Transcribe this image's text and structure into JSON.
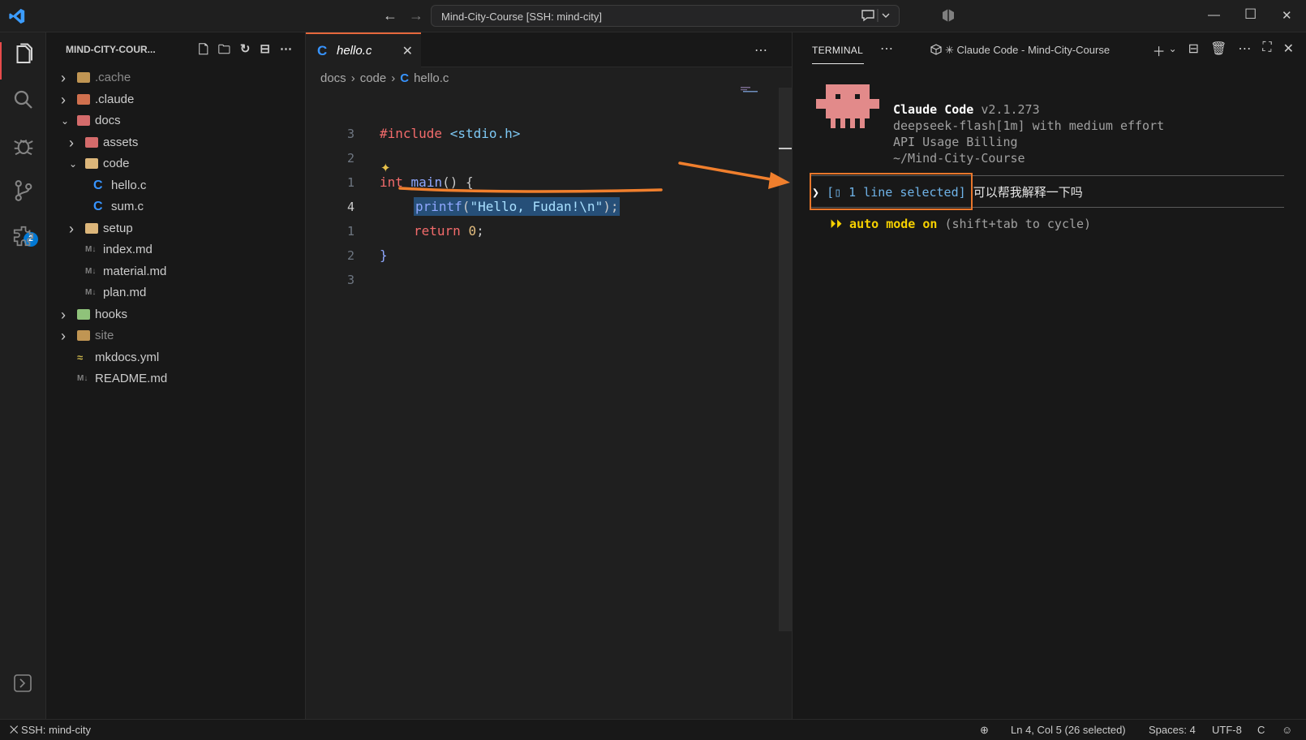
{
  "window": {
    "command_center": "Mind-City-Course [SSH: mind-city]"
  },
  "activity_bar": {
    "scm_badge": "2"
  },
  "explorer": {
    "title": "MIND-CITY-COUR...",
    "items": [
      {
        "label": ".cache",
        "type": "folder",
        "expanded": false,
        "dim": true
      },
      {
        "label": ".claude",
        "type": "folder",
        "expanded": false
      },
      {
        "label": "docs",
        "type": "folder",
        "expanded": true
      },
      {
        "label": "assets",
        "type": "folder",
        "expanded": false
      },
      {
        "label": "code",
        "type": "folder",
        "expanded": true
      },
      {
        "label": "hello.c",
        "type": "c-file"
      },
      {
        "label": "sum.c",
        "type": "c-file"
      },
      {
        "label": "setup",
        "type": "folder",
        "expanded": false
      },
      {
        "label": "index.md",
        "type": "md-file"
      },
      {
        "label": "material.md",
        "type": "md-file"
      },
      {
        "label": "plan.md",
        "type": "md-file"
      },
      {
        "label": "hooks",
        "type": "folder",
        "expanded": false
      },
      {
        "label": "site",
        "type": "folder",
        "expanded": false,
        "dim": true
      },
      {
        "label": "mkdocs.yml",
        "type": "yml-file"
      },
      {
        "label": "README.md",
        "type": "md-file"
      }
    ]
  },
  "editor": {
    "tab_label": "hello.c",
    "breadcrumb": [
      "docs",
      "code",
      "hello.c"
    ],
    "line_numbers": [
      "3",
      "2",
      "1",
      "4",
      "1",
      "2",
      "3"
    ],
    "code": {
      "include_kw": "#include",
      "include_path": "<stdio.h>",
      "int_kw": "int",
      "main_fn": "main",
      "main_rest": "() {",
      "printf_fn": "printf",
      "printf_open": "(",
      "printf_str": "\"Hello, Fudan!\\n\"",
      "printf_close": ");",
      "return_kw": "return",
      "return_val": "0",
      "return_semi": ";",
      "close_brace": "}"
    }
  },
  "terminal": {
    "title": "TERMINAL",
    "session": "✳ Claude Code - Mind-City-Course",
    "app_name": "Claude Code",
    "version": "v2.1.273",
    "model_line": "deepseek-flash[1m] with medium effort",
    "billing_line": "API Usage Billing",
    "path_line": "~/Mind-City-Course",
    "prompt_chevron": "❯",
    "selection_chip": "[▯ 1 line selected]",
    "prompt_text": "可以帮我解释一下吗",
    "mode_arrows": "⏵⏵",
    "mode_label": "auto mode on",
    "mode_hint": "(shift+tab to cycle)"
  },
  "status_bar": {
    "remote": "SSH: mind-city",
    "cursor": "Ln 4, Col 5 (26 selected)",
    "spaces": "Spaces: 4",
    "encoding": "UTF-8",
    "language": "C"
  },
  "colors": {
    "accent_tab": "#e5673c",
    "annotation": "#f07f2d",
    "selection": "#264f78",
    "badge": "#0078d4",
    "mascot": "#e28a8a"
  }
}
